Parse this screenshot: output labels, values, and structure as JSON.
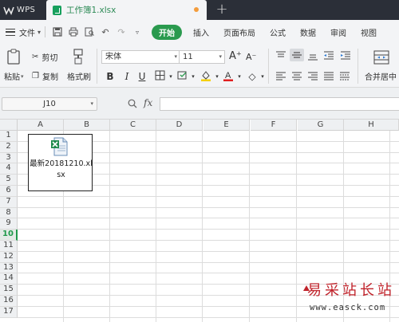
{
  "titlebar": {
    "app_tab": "WPS",
    "doc_tab": "工作簿1.xlsx",
    "new_tab": "+"
  },
  "menubar": {
    "file": "文件",
    "start": "开始",
    "items": [
      "插入",
      "页面布局",
      "公式",
      "数据",
      "审阅",
      "视图"
    ]
  },
  "ribbon": {
    "paste": "粘贴",
    "cut": "剪切",
    "copy": "复制",
    "format_painter": "格式刷",
    "font_name": "宋体",
    "font_size": "11",
    "merge_center": "合并居中",
    "bold": "B",
    "italic": "I",
    "underline": "U",
    "font_grow": "A⁺",
    "font_shrink": "A⁻",
    "font_color_letter": "A",
    "fill_color": "#f5d000",
    "font_color": "#e02020"
  },
  "formulabar": {
    "cell_ref": "J10",
    "fx": "fx"
  },
  "grid": {
    "columns": [
      "A",
      "B",
      "C",
      "D",
      "E",
      "F",
      "G",
      "H"
    ],
    "rows": [
      "1",
      "2",
      "3",
      "4",
      "5",
      "6",
      "7",
      "8",
      "9",
      "10",
      "11",
      "12",
      "13",
      "14",
      "15",
      "16",
      "17"
    ],
    "active_row": "10"
  },
  "embedded_object": {
    "name_line1": "最新20181210.xl",
    "name_line2": "sx"
  },
  "watermark": {
    "chinese": "易采站长站",
    "url": "www.easck.com"
  }
}
